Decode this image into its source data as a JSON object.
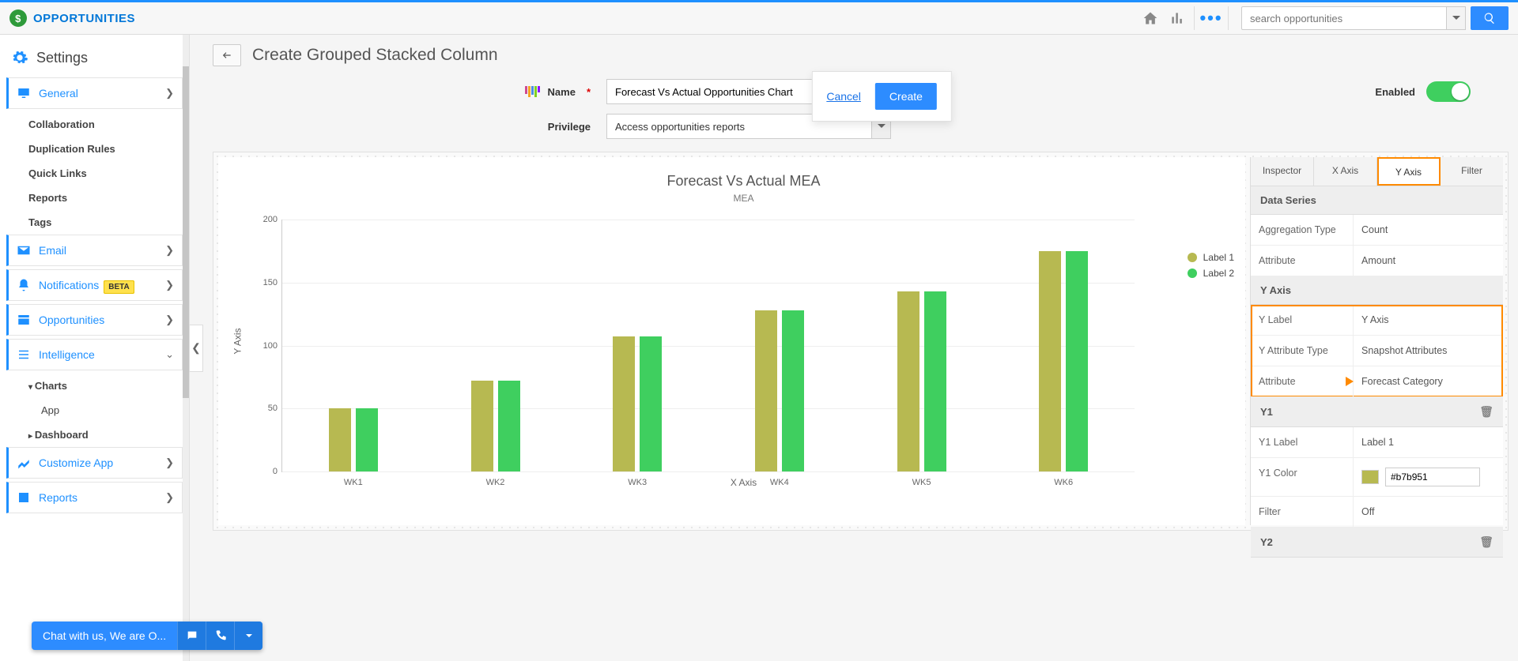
{
  "brand": "OPPORTUNITIES",
  "search": {
    "placeholder": "search opportunities"
  },
  "settings_header": "Settings",
  "sidebar": {
    "general": "General",
    "general_children": [
      "Collaboration",
      "Duplication Rules",
      "Quick Links",
      "Reports",
      "Tags"
    ],
    "email": "Email",
    "notifications": "Notifications",
    "beta": "BETA",
    "opportunities": "Opportunities",
    "intelligence": "Intelligence",
    "intelligence_children": {
      "charts": "Charts",
      "app": "App",
      "dashboard": "Dashboard"
    },
    "customize": "Customize App",
    "reports": "Reports"
  },
  "page": {
    "title": "Create Grouped Stacked Column",
    "cancel": "Cancel",
    "create": "Create",
    "name_label": "Name",
    "name_value": "Forecast Vs Actual Opportunities Chart",
    "privilege_label": "Privilege",
    "privilege_value": "Access opportunities reports",
    "enabled_label": "Enabled"
  },
  "chart_data": {
    "type": "bar",
    "title": "Forecast Vs Actual MEA",
    "subtitle": "MEA",
    "xlabel": "X Axis",
    "ylabel": "Y Axis",
    "ylim": [
      0,
      200
    ],
    "yticks": [
      0,
      50,
      100,
      150,
      200
    ],
    "categories": [
      "WK1",
      "WK2",
      "WK3",
      "WK4",
      "WK5",
      "WK6"
    ],
    "series": [
      {
        "name": "Label 1",
        "color": "#b7b951",
        "values": [
          50,
          72,
          107,
          128,
          143,
          175
        ]
      },
      {
        "name": "Label 2",
        "color": "#3fcf5f",
        "values": [
          50,
          72,
          107,
          128,
          143,
          175
        ]
      }
    ]
  },
  "inspector": {
    "tabs": [
      "Inspector",
      "X Axis",
      "Y Axis",
      "Filter"
    ],
    "active_tab": "Y Axis",
    "data_series_header": "Data Series",
    "aggregation_type_k": "Aggregation Type",
    "aggregation_type_v": "Count",
    "attribute_k": "Attribute",
    "attribute_v": "Amount",
    "yaxis_header": "Y Axis",
    "ylabel_k": "Y Label",
    "ylabel_v": "Y Axis",
    "yattrtype_k": "Y Attribute Type",
    "yattrtype_v": "Snapshot Attributes",
    "yattr_k": "Attribute",
    "yattr_v": "Forecast Category",
    "y1_header": "Y1",
    "y1label_k": "Y1 Label",
    "y1label_v": "Label 1",
    "y1color_k": "Y1 Color",
    "y1color_v": "#b7b951",
    "filter_k": "Filter",
    "filter_v": "Off",
    "y2_header": "Y2"
  },
  "chat": "Chat with us, We are O..."
}
